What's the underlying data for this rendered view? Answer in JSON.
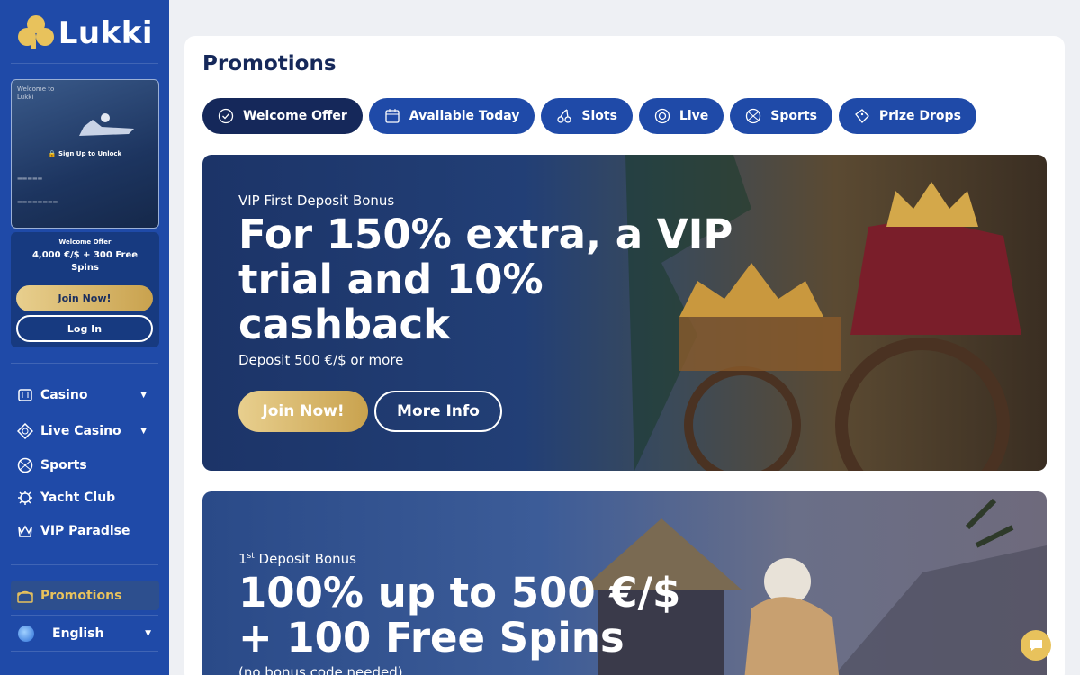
{
  "brand": {
    "name": "Lukki"
  },
  "sidebar": {
    "promo_card": {
      "title": "Welcome to Lukki",
      "lock_text": "Sign Up to Unlock"
    },
    "welcome": {
      "label": "Welcome Offer",
      "offer": "4,000 €/$ + 300 Free Spins",
      "join_label": "Join Now!",
      "login_label": "Log In"
    },
    "nav": [
      {
        "label": "Casino",
        "icon": "slot-machine-icon",
        "has_caret": true
      },
      {
        "label": "Live Casino",
        "icon": "diamond-chip-icon",
        "has_caret": true
      },
      {
        "label": "Sports",
        "icon": "basketball-icon",
        "has_caret": false
      },
      {
        "label": "Yacht Club",
        "icon": "gear-wheel-icon",
        "has_caret": false
      },
      {
        "label": "VIP Paradise",
        "icon": "crown-icon",
        "has_caret": false
      }
    ],
    "promotions_label": "Promotions",
    "language": "English"
  },
  "main": {
    "title": "Promotions",
    "tabs": [
      {
        "label": "Welcome Offer",
        "icon": "check-badge-icon",
        "active": true
      },
      {
        "label": "Available Today",
        "icon": "calendar-icon",
        "active": false
      },
      {
        "label": "Slots",
        "icon": "cherries-icon",
        "active": false
      },
      {
        "label": "Live",
        "icon": "roulette-chip-icon",
        "active": false
      },
      {
        "label": "Sports",
        "icon": "basketball-icon",
        "active": false
      },
      {
        "label": "Prize Drops",
        "icon": "ticket-icon",
        "active": false
      }
    ],
    "banner1": {
      "subtitle": "VIP First Deposit Bonus",
      "headline_1": "For 150% extra, a VIP",
      "headline_2": "trial and 10%",
      "headline_3": "cashback",
      "note": "Deposit 500 €/$ or more",
      "join_label": "Join Now!",
      "more_label": "More Info"
    },
    "banner2": {
      "subtitle_sup": "st",
      "subtitle_num": "1",
      "subtitle": "Deposit Bonus",
      "headline_1": "100% up to 500 €/$",
      "headline_2": "+ 100 Free Spins",
      "note": "(no bonus code needed)"
    }
  },
  "colors": {
    "sidebar": "#1f4aa8",
    "navy": "#15285a",
    "gold": "#e8c25c"
  }
}
